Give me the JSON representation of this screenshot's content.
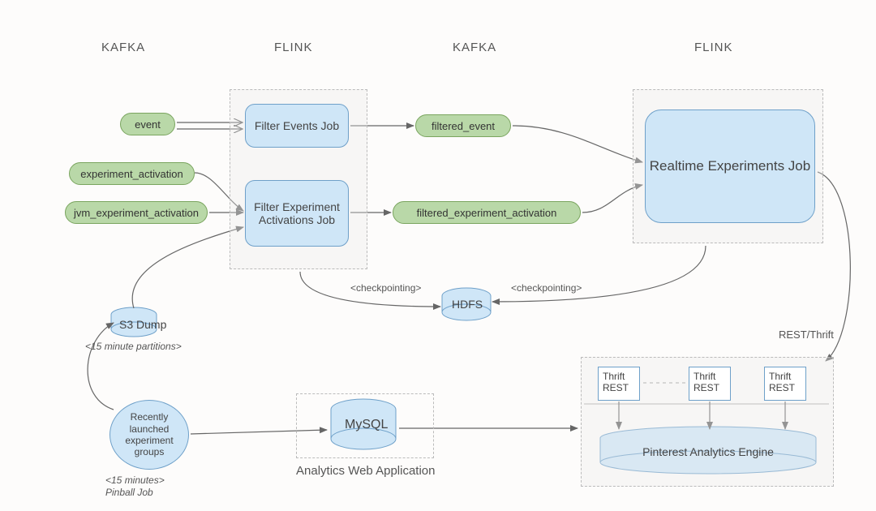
{
  "columns": {
    "c1": "KAFKA",
    "c2": "FLINK",
    "c3": "KAFKA",
    "c4": "FLINK"
  },
  "topics": {
    "event": "event",
    "exp_act": "experiment_activation",
    "jvm_exp_act": "jvm_experiment_activation",
    "filtered_event": "filtered_event",
    "filtered_exp_act": "filtered_experiment_activation"
  },
  "jobs": {
    "filter_events": "Filter Events Job",
    "filter_activations": "Filter Experiment Activations Job",
    "realtime": "Realtime Experiments Job"
  },
  "storage": {
    "hdfs": "HDFS",
    "s3": "S3 Dump",
    "mysql": "MySQL",
    "engine": "Pinterest Analytics Engine"
  },
  "nodes": {
    "recent_groups": "Recently launched experiment groups"
  },
  "thrift": {
    "label": "Thrift REST"
  },
  "annotations": {
    "checkpointing": "<checkpointing>",
    "rest_thrift": "REST/Thrift",
    "s3_partitions": "<15 minute partitions>",
    "pinball_time": "<15 minutes>",
    "pinball_job": "Pinball Job",
    "analytics_app": "Analytics Web Application"
  }
}
